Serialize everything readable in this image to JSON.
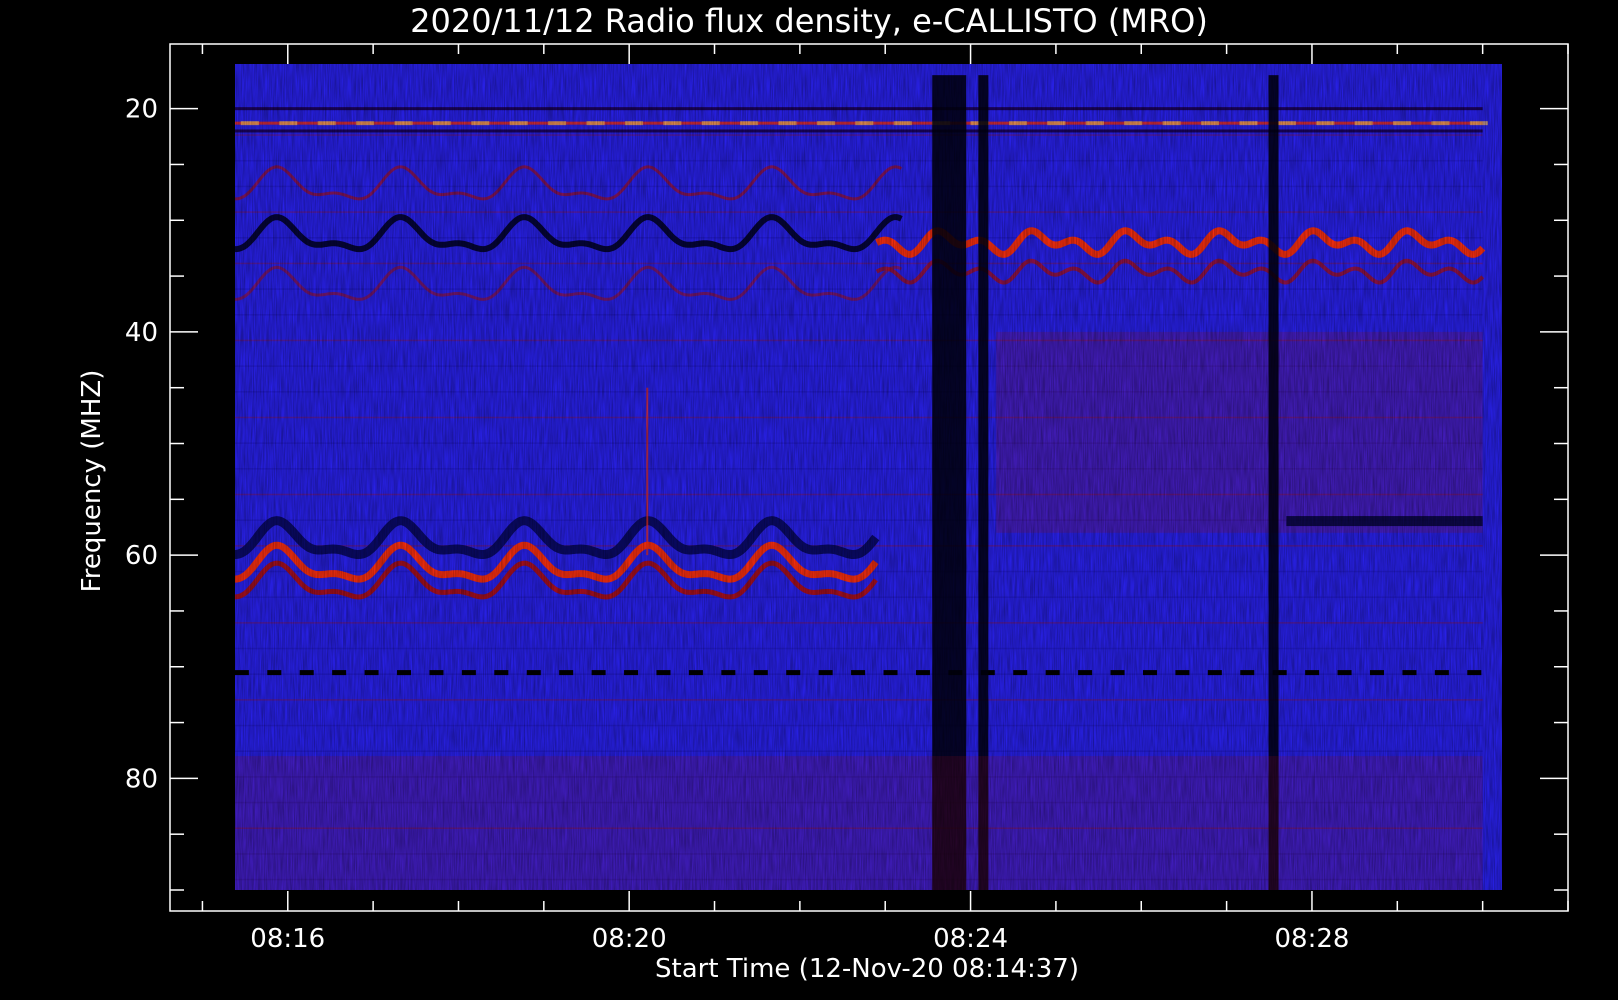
{
  "chart_data": {
    "type": "heatmap",
    "title": "2020/11/12  Radio flux density, e-CALLISTO (MRO)",
    "xlabel": "Start Time (12-Nov-20 08:14:37)",
    "ylabel": "Frequency (MHZ)",
    "x_ticks": [
      "08:16",
      "08:20",
      "08:24",
      "08:28"
    ],
    "x_tick_minutes": [
      16,
      20,
      24,
      28
    ],
    "x_range_minutes": [
      14.62,
      31.0
    ],
    "y_ticks": [
      20,
      40,
      60,
      80
    ],
    "y_range_mhz": [
      90,
      16
    ],
    "colors": {
      "background": "#000000",
      "low": "#000000",
      "mid": "#2222ff",
      "elevated": "#aa1020",
      "high": "#ff3010",
      "peak": "#ffc060"
    },
    "features": [
      {
        "name": "wavy emission band",
        "freq_mhz": 61,
        "start_min": 14.95,
        "end_min": 22.9,
        "level": "high"
      },
      {
        "name": "emission band",
        "freq_mhz": 32,
        "start_min": 22.9,
        "end_min": 30.0,
        "level": "high"
      },
      {
        "name": "interference lines",
        "freq_mhz": 21,
        "start_min": 14.95,
        "end_min": 30.0,
        "level": "peak"
      },
      {
        "name": "gap",
        "time_min": 23.75,
        "level": "low"
      },
      {
        "name": "gap",
        "time_min": 24.15,
        "level": "low"
      },
      {
        "name": "gap",
        "time_min": 27.55,
        "level": "low"
      }
    ]
  }
}
